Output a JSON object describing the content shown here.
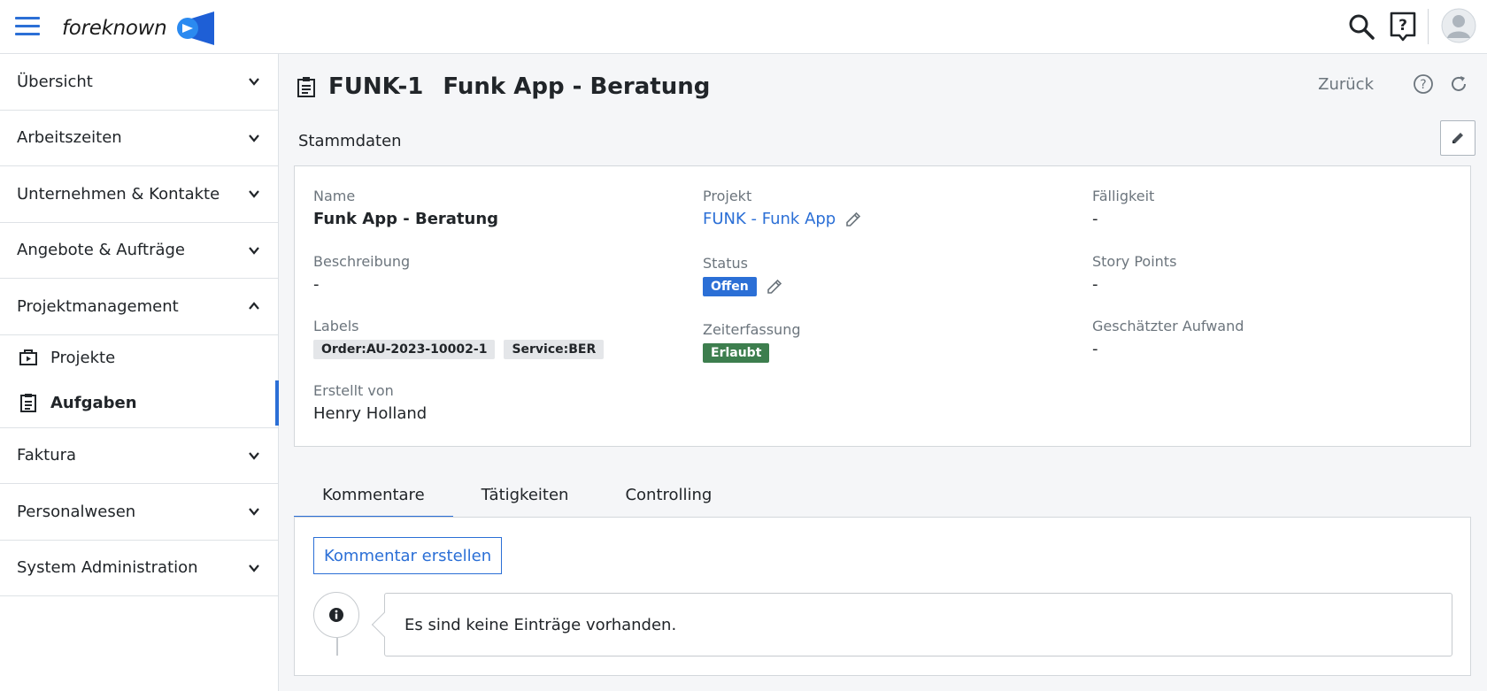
{
  "header": {
    "brand": "foreknown",
    "icons": [
      "menu-icon",
      "search-icon",
      "help-icon",
      "avatar-icon"
    ],
    "accent": "#2b6fd6"
  },
  "sidebar": {
    "items": [
      {
        "label": "Übersicht",
        "expanded": false
      },
      {
        "label": "Arbeitszeiten",
        "expanded": false
      },
      {
        "label": "Unternehmen & Kontakte",
        "expanded": false
      },
      {
        "label": "Angebote & Aufträge",
        "expanded": false
      },
      {
        "label": "Projektmanagement",
        "expanded": true
      },
      {
        "label": "Faktura",
        "expanded": false
      },
      {
        "label": "Personalwesen",
        "expanded": false
      },
      {
        "label": "System Administration",
        "expanded": false
      }
    ],
    "sub_items": [
      {
        "label": "Projekte",
        "icon": "project-play-icon",
        "active": false
      },
      {
        "label": "Aufgaben",
        "icon": "clipboard-icon",
        "active": true
      }
    ]
  },
  "page": {
    "code": "FUNK-1",
    "title": "Funk App - Beratung",
    "back": "Zurück",
    "section": "Stammdaten"
  },
  "fields": {
    "name_label": "Name",
    "name_value": "Funk App - Beratung",
    "desc_label": "Beschreibung",
    "desc_value": "-",
    "labels_label": "Labels",
    "labels": [
      "Order:AU-2023-10002-1",
      "Service:BER"
    ],
    "created_label": "Erstellt von",
    "created_value": "Henry Holland",
    "project_label": "Projekt",
    "project_value": "FUNK - Funk App",
    "status_label": "Status",
    "status_value": "Offen",
    "time_label": "Zeiterfassung",
    "time_value": "Erlaubt",
    "due_label": "Fälligkeit",
    "due_value": "-",
    "sp_label": "Story Points",
    "sp_value": "-",
    "effort_label": "Geschätzter Aufwand",
    "effort_value": "-"
  },
  "tabs": {
    "items": [
      "Kommentare",
      "Tätigkeiten",
      "Controlling"
    ],
    "active": 0,
    "create_label": "Kommentar erstellen",
    "empty_text": "Es sind keine Einträge vorhanden."
  },
  "colors": {
    "status_open": "#2b6fd6",
    "time_allowed": "#3d7e4e"
  }
}
